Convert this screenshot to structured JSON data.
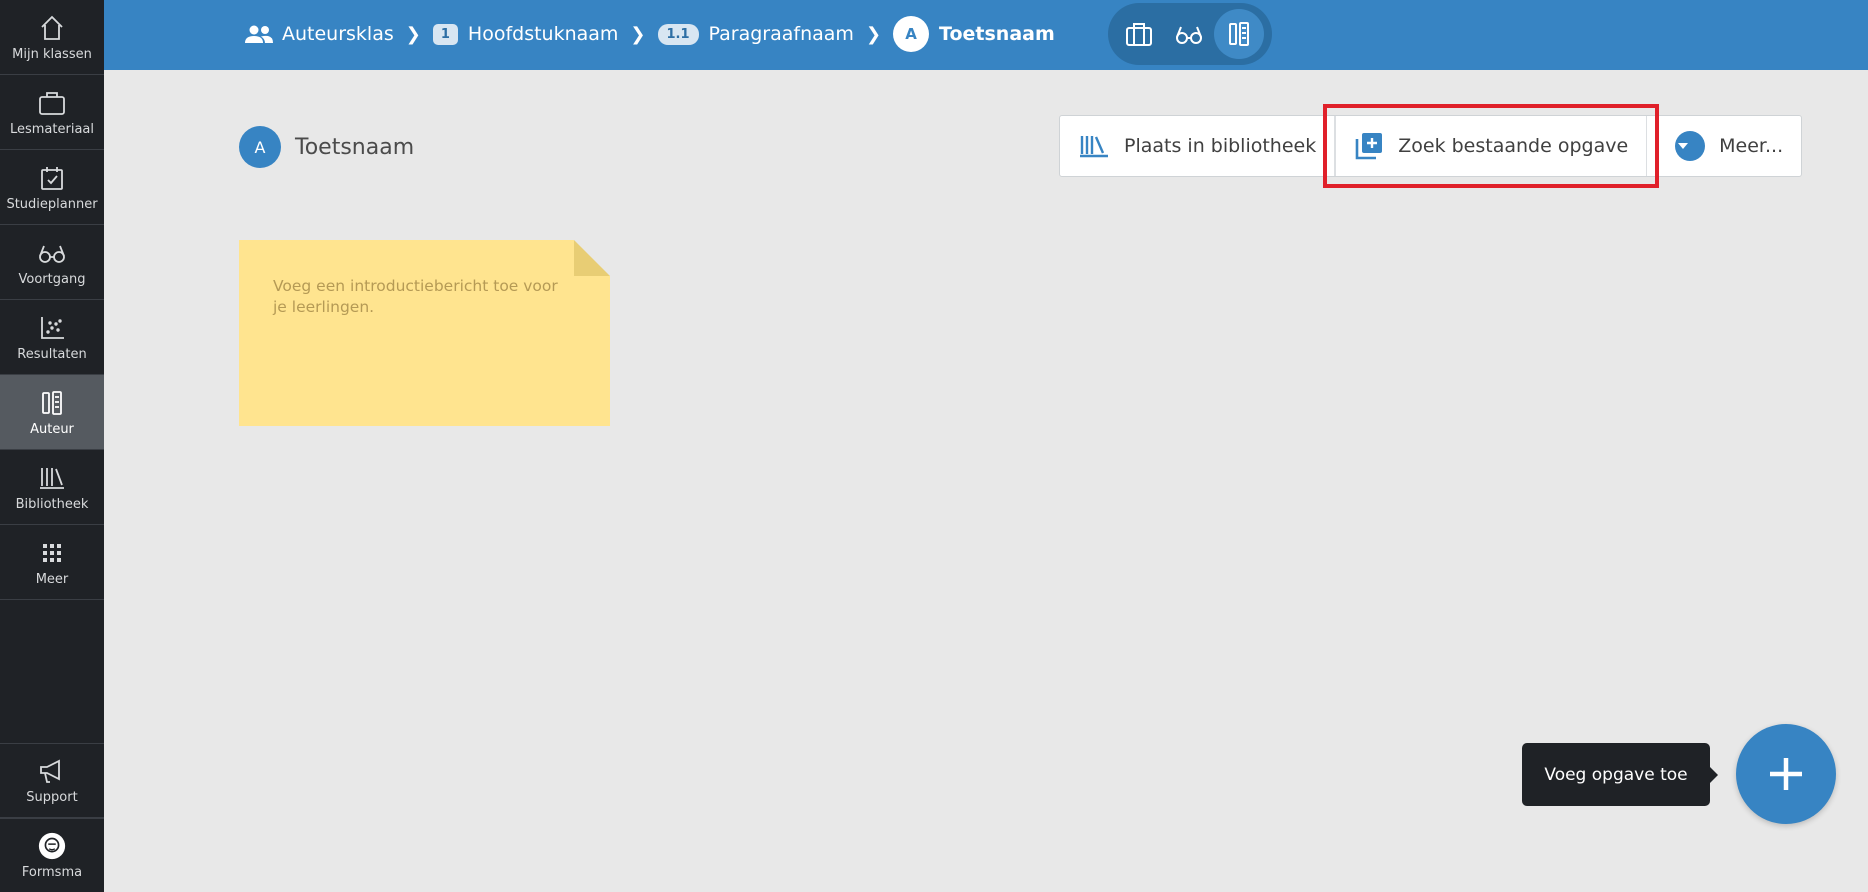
{
  "sidebar": {
    "items": [
      {
        "label": "Mijn klassen",
        "icon": "home-icon"
      },
      {
        "label": "Lesmateriaal",
        "icon": "briefcase-icon"
      },
      {
        "label": "Studieplanner",
        "icon": "calendar-check-icon"
      },
      {
        "label": "Voortgang",
        "icon": "glasses-icon"
      },
      {
        "label": "Resultaten",
        "icon": "scatter-chart-icon"
      },
      {
        "label": "Auteur",
        "icon": "author-tools-icon",
        "active": true
      },
      {
        "label": "Bibliotheek",
        "icon": "library-icon"
      },
      {
        "label": "Meer",
        "icon": "grid-icon"
      }
    ],
    "bottom": [
      {
        "label": "Support",
        "icon": "megaphone-icon"
      },
      {
        "label": "Formsma",
        "icon": "user-avatar-icon"
      }
    ]
  },
  "breadcrumb": {
    "class": "Auteursklas",
    "chapter_num": "1",
    "chapter": "Hoofdstuknaam",
    "section_num": "1.1",
    "section": "Paragraafnaam",
    "test_badge": "A",
    "test": "Toetsnaam"
  },
  "header": {
    "badge": "A",
    "title": "Toetsnaam"
  },
  "actions": {
    "library": "Plaats in bibliotheek",
    "search": "Zoek bestaande opgave",
    "more": "Meer..."
  },
  "note": {
    "placeholder": "Voeg een introductiebericht toe voor je leerlingen."
  },
  "fab": {
    "tooltip": "Voeg opgave toe"
  },
  "colors": {
    "primary": "#3784c3",
    "sidebar": "#1f2226",
    "note": "#ffe48f",
    "highlight": "#e0202a"
  }
}
